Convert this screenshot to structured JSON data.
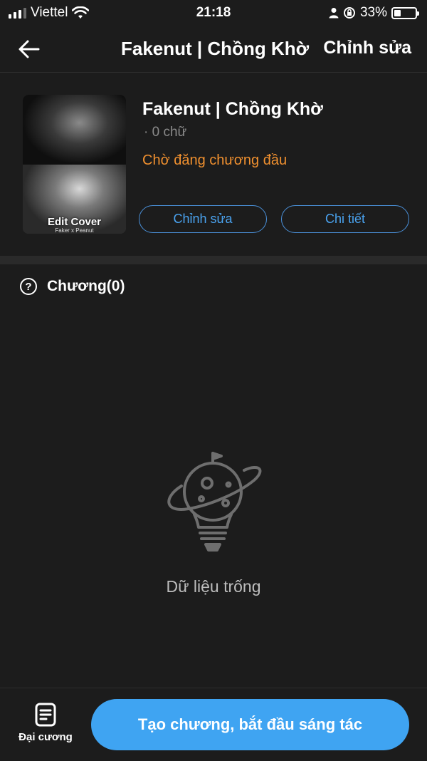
{
  "status_bar": {
    "carrier": "Viettel",
    "time": "21:18",
    "battery": "33%",
    "battery_level": 0.33
  },
  "nav": {
    "title": "Fakenut | Chồng Khờ",
    "edit_label": "Chỉnh sửa"
  },
  "book": {
    "cover_label": "Edit Cover",
    "cover_sub": "Faker x Peanut",
    "title": "Fakenut | Chồng Khờ",
    "words": "· 0 chữ",
    "status": "Chờ đăng chương đầu",
    "status_color": "#f0902f",
    "edit_button": "Chỉnh sửa",
    "detail_button": "Chi tiết"
  },
  "chapters": {
    "label": "Chương(0)",
    "help_icon": "question-circle-icon"
  },
  "empty_state": {
    "icon": "planet-bulb-icon",
    "text": "Dữ liệu trống"
  },
  "bottom_bar": {
    "outline_label": "Đại cương",
    "outline_icon": "document-icon",
    "create_label": "Tạo chương, bắt đầu sáng tác",
    "accent_color": "#3fa4f2"
  }
}
